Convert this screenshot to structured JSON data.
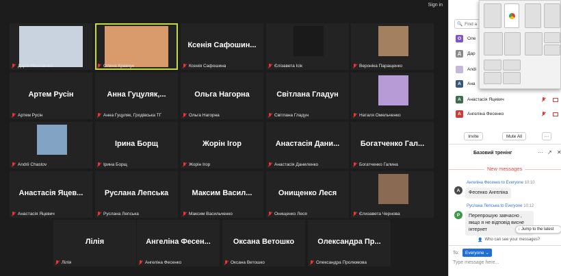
{
  "header": {
    "signin": "Sign in"
  },
  "tiles": [
    {
      "big": "",
      "name": "Дар'я Ніколаєнко",
      "photo": true
    },
    {
      "big": "",
      "name": "Олена Кравчук",
      "photo": true,
      "active": true
    },
    {
      "big": "Ксенія Сафошин...",
      "name": "Ксенія Сафошина"
    },
    {
      "big": "",
      "name": "Єлізавета Ісік",
      "photo": true
    },
    {
      "big": "",
      "name": "Вероніка Паращенко",
      "photo": true
    },
    {
      "big": "Артем Русін",
      "name": "Артем Русін"
    },
    {
      "big": "Анна Гуцуляк,...",
      "name": "Анна Гуцуляк, Гродівська ТГ"
    },
    {
      "big": "Ольга Нагорна",
      "name": "Ольга Нагорна"
    },
    {
      "big": "Світлана Гладун",
      "name": "Світлана Гладун"
    },
    {
      "big": "",
      "name": "Наталя Омельченко",
      "photo": true
    },
    {
      "big": "",
      "name": "Andrii Chastov",
      "photo": true
    },
    {
      "big": "Ірина Борщ",
      "name": "Ірина Борщ"
    },
    {
      "big": "Жорін Ігор",
      "name": "Жорін Ігор"
    },
    {
      "big": "Анастасія Дани...",
      "name": "Анастасія Даниленко"
    },
    {
      "big": "Богатченко Гал...",
      "name": "Богатченко Галина"
    },
    {
      "big": "Анастасія Яцев...",
      "name": "Анастасія Яцевич"
    },
    {
      "big": "Руслана Лепська",
      "name": "Руслана Лепська"
    },
    {
      "big": "Максим Васил...",
      "name": "Максим Васильченко"
    },
    {
      "big": "Онищенко Леся",
      "name": "Онищенко Леся"
    },
    {
      "big": "",
      "name": "Єлизавета Чернова",
      "photo": true
    },
    {
      "big": "Лілія",
      "name": "Лілія"
    },
    {
      "big": "Ангеліна Фесен...",
      "name": "Ангеліна Фесенко"
    },
    {
      "big": "Оксана Ветошко",
      "name": "Оксана Ветошко"
    },
    {
      "big": "Олександра Пр...",
      "name": "Олександра Пролюмова"
    }
  ],
  "panel": {
    "search_placeholder": "Find a",
    "participants": [
      {
        "initial": "O",
        "color": "#7b58c8",
        "name": "Оле"
      },
      {
        "initial": "Д",
        "color": "#8a8a8a",
        "name": "Дар"
      },
      {
        "initial": "",
        "color": "#c7b7d6",
        "name": "Andi"
      },
      {
        "initial": "A",
        "color": "#39597a",
        "name": "Ана"
      },
      {
        "initial": "A",
        "color": "#3e6d4b",
        "name": "Анастасія Яцевич"
      },
      {
        "initial": "A",
        "color": "#cf3b3b",
        "name": "Ангеліна Фесенко"
      }
    ],
    "invite": "Invite",
    "mute_all": "Mute All",
    "more": "···",
    "chat_title": "Базовий тренінг",
    "new_messages": "New messages",
    "messages": [
      {
        "initial": "A",
        "color": "#4b4b4b",
        "sender": "Ангеліна Фесенко to Everyone",
        "time": "10:10",
        "text": "Фесенко Ангеліна"
      },
      {
        "initial": "P",
        "color": "#3d9a48",
        "sender": "Руслана Лепська to Everyone",
        "time": "10:12",
        "text": "Перепрошую завчасно , якщо я не відповід висне інтернет"
      }
    ],
    "jump": "Jump to the latest",
    "who_can_see": "Who can see your messages?",
    "to_label": "To:",
    "to_value": "Everyone",
    "input_placeholder": "Type message here..."
  },
  "colors": {
    "active_border": "#c6de3a",
    "link": "#3572c6",
    "new_messages": "#e0433f"
  }
}
